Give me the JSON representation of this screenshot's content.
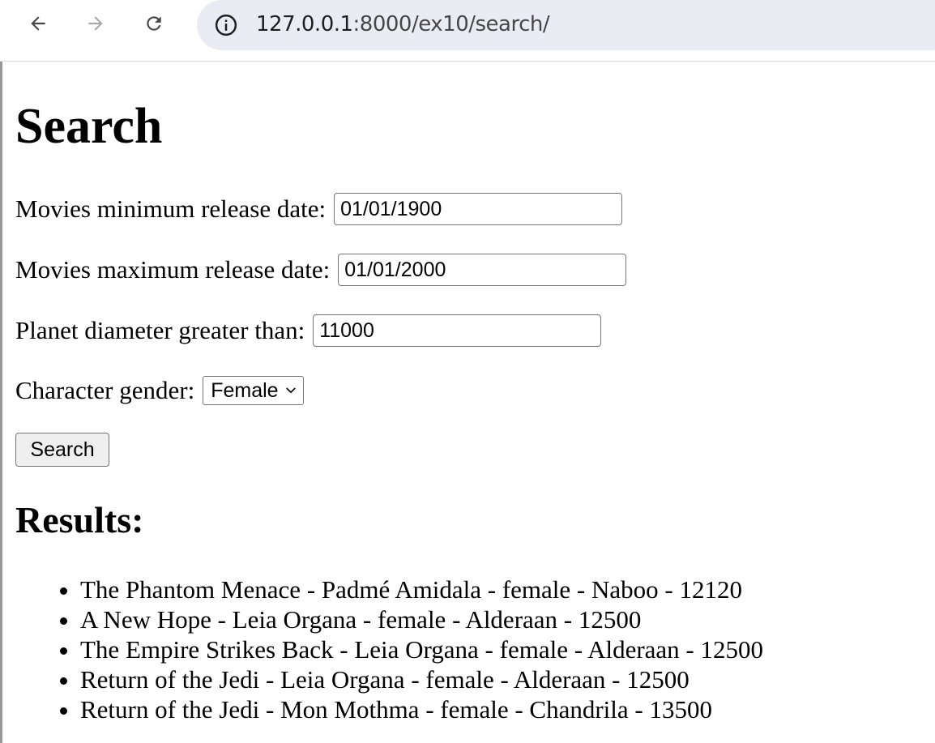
{
  "browser": {
    "url_host": "127.0.0.1",
    "url_rest": ":8000/ex10/search/",
    "icons": {
      "back": "arrow-left-icon",
      "forward": "arrow-right-icon",
      "reload": "reload-icon",
      "info": "info-icon"
    }
  },
  "page": {
    "title": "Search",
    "form": {
      "min_date_label": "Movies minimum release date:",
      "min_date_value": "01/01/1900",
      "max_date_label": "Movies maximum release date:",
      "max_date_value": "01/01/2000",
      "diameter_label": "Planet diameter greater than:",
      "diameter_value": "11000",
      "gender_label": "Character gender:",
      "gender_selected": "Female",
      "submit_label": "Search"
    },
    "results_title": "Results:",
    "results": [
      "The Phantom Menace - Padmé Amidala - female - Naboo - 12120",
      "A New Hope - Leia Organa - female - Alderaan - 12500",
      "The Empire Strikes Back - Leia Organa - female - Alderaan - 12500",
      "Return of the Jedi - Leia Organa - female - Alderaan - 12500",
      "Return of the Jedi - Mon Mothma - female - Chandrila - 13500"
    ]
  },
  "colors": {
    "omnibox_bg": "#e9ecf3",
    "button_bg": "#efefef",
    "input_border": "#767676"
  }
}
